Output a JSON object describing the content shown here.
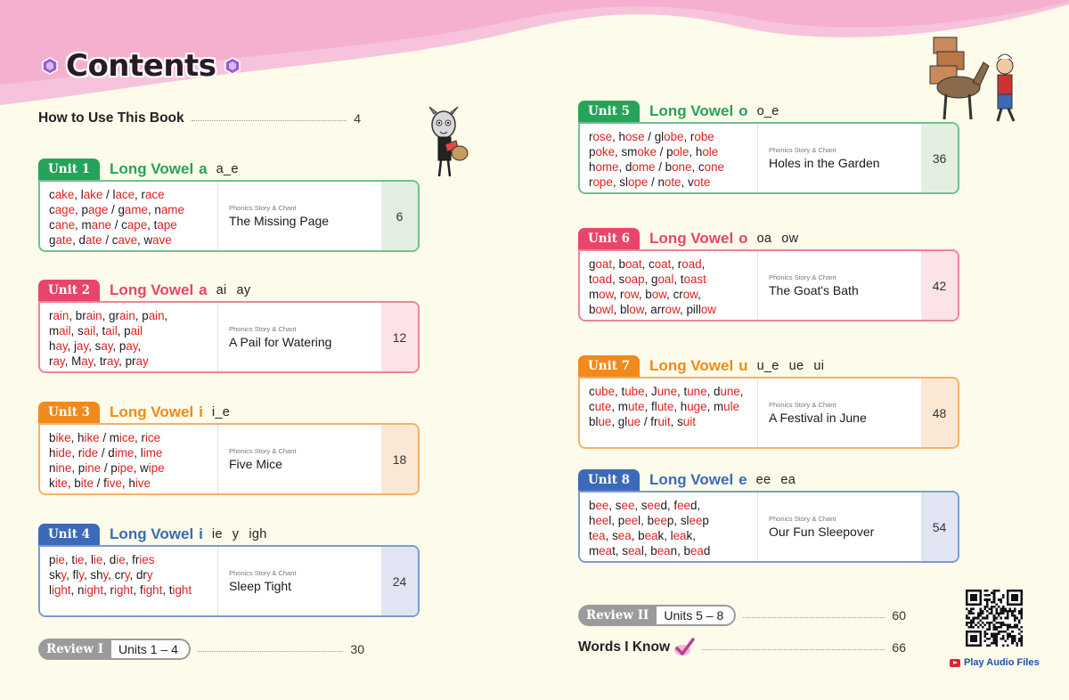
{
  "title": "Contents",
  "how_to_use": {
    "label": "How to Use This Book",
    "page": "4"
  },
  "story_label": "Phonics Story & Chant",
  "units": [
    {
      "tag": "Unit 1",
      "long_vowel": "Long Vowel",
      "letter": "a",
      "patterns": [
        "a_e"
      ],
      "color": "#26a35a",
      "bg": "#e3efe1",
      "words": [
        [
          [
            "c",
            "ake"
          ],
          [
            ", l",
            "ake"
          ],
          [
            " / l",
            "ace"
          ],
          [
            ", r",
            "ace"
          ]
        ],
        [
          [
            "c",
            "age"
          ],
          [
            ", p",
            "age"
          ],
          [
            " / g",
            "ame"
          ],
          [
            ", n",
            "ame"
          ]
        ],
        [
          [
            "c",
            "ane"
          ],
          [
            ", m",
            "ane"
          ],
          [
            " / c",
            "ape"
          ],
          [
            ", t",
            "ape"
          ]
        ],
        [
          [
            "g",
            "ate"
          ],
          [
            ", d",
            "ate"
          ],
          [
            " / c",
            "ave"
          ],
          [
            ", w",
            "ave"
          ]
        ]
      ],
      "story": "The Missing Page",
      "page": "6"
    },
    {
      "tag": "Unit 2",
      "long_vowel": "Long Vowel",
      "letter": "a",
      "patterns": [
        "ai",
        "ay"
      ],
      "color": "#e8456b",
      "bg": "#fbe3e7",
      "words": [
        [
          [
            "r",
            "ain"
          ],
          [
            ", br",
            "ain"
          ],
          [
            ", gr",
            "ain"
          ],
          [
            ", p",
            "ain"
          ],
          [
            ",",
            ""
          ]
        ],
        [
          [
            "m",
            "ail"
          ],
          [
            ", s",
            "ail"
          ],
          [
            ", t",
            "ail"
          ],
          [
            ", p",
            "ail"
          ]
        ],
        [
          [
            "h",
            "ay"
          ],
          [
            ", j",
            "ay"
          ],
          [
            ", s",
            "ay"
          ],
          [
            ", p",
            "ay"
          ],
          [
            ",",
            ""
          ]
        ],
        [
          [
            "r",
            "ay"
          ],
          [
            ", M",
            "ay"
          ],
          [
            ", tr",
            "ay"
          ],
          [
            ", pr",
            "ay"
          ]
        ]
      ],
      "story": "A Pail for Watering",
      "page": "12"
    },
    {
      "tag": "Unit 3",
      "long_vowel": "Long Vowel",
      "letter": "i",
      "patterns": [
        "i_e"
      ],
      "color": "#f08a1c",
      "bg": "#fbe8d4",
      "words": [
        [
          [
            "b",
            "ike"
          ],
          [
            ", h",
            "ike"
          ],
          [
            " / m",
            "ice"
          ],
          [
            ", r",
            "ice"
          ]
        ],
        [
          [
            "h",
            "ide"
          ],
          [
            ", r",
            "ide"
          ],
          [
            " / d",
            "ime"
          ],
          [
            ", l",
            "ime"
          ]
        ],
        [
          [
            "n",
            "ine"
          ],
          [
            ", p",
            "ine"
          ],
          [
            " / p",
            "ipe"
          ],
          [
            ", w",
            "ipe"
          ]
        ],
        [
          [
            "k",
            "ite"
          ],
          [
            ", b",
            "ite"
          ],
          [
            " / f",
            "ive"
          ],
          [
            ", h",
            "ive"
          ]
        ]
      ],
      "story": "Five Mice",
      "page": "18"
    },
    {
      "tag": "Unit 4",
      "long_vowel": "Long Vowel",
      "letter": "i",
      "patterns": [
        "ie",
        "y",
        "igh"
      ],
      "color": "#3b6ab8",
      "bg": "#e1e5f3",
      "words": [
        [
          [
            "p",
            "ie"
          ],
          [
            ", t",
            "ie"
          ],
          [
            ", l",
            "ie"
          ],
          [
            ", d",
            "ie"
          ],
          [
            ", fr",
            "ies"
          ]
        ],
        [
          [
            "sk",
            "y"
          ],
          [
            ", fl",
            "y"
          ],
          [
            ", sh",
            "y"
          ],
          [
            ", cr",
            "y"
          ],
          [
            ", dr",
            "y"
          ]
        ],
        [
          [
            "l",
            "ight"
          ],
          [
            ", n",
            "ight"
          ],
          [
            ", r",
            "ight"
          ],
          [
            ", f",
            "ight"
          ],
          [
            ", t",
            "ight"
          ]
        ]
      ],
      "story": "Sleep Tight",
      "page": "24"
    },
    {
      "tag": "Unit 5",
      "long_vowel": "Long Vowel",
      "letter": "o",
      "patterns": [
        "o_e"
      ],
      "color": "#26a35a",
      "bg": "#e3efe1",
      "words": [
        [
          [
            "r",
            "ose"
          ],
          [
            ", h",
            "ose"
          ],
          [
            " / gl",
            "obe"
          ],
          [
            ", r",
            "obe"
          ]
        ],
        [
          [
            "p",
            "oke"
          ],
          [
            ", sm",
            "oke"
          ],
          [
            " / p",
            "ole"
          ],
          [
            ", h",
            "ole"
          ]
        ],
        [
          [
            "h",
            "ome"
          ],
          [
            ", d",
            "ome"
          ],
          [
            " / b",
            "one"
          ],
          [
            ", c",
            "one"
          ]
        ],
        [
          [
            "r",
            "ope"
          ],
          [
            ", sl",
            "ope"
          ],
          [
            " / n",
            "ote"
          ],
          [
            ", v",
            "ote"
          ]
        ]
      ],
      "story": "Holes in the Garden",
      "page": "36"
    },
    {
      "tag": "Unit 6",
      "long_vowel": "Long Vowel",
      "letter": "o",
      "patterns": [
        "oa",
        "ow"
      ],
      "color": "#e8456b",
      "bg": "#fbe3e7",
      "words": [
        [
          [
            "g",
            "oat"
          ],
          [
            ", b",
            "oat"
          ],
          [
            ", c",
            "oat"
          ],
          [
            ", r",
            "oad"
          ],
          [
            ",",
            ""
          ]
        ],
        [
          [
            "t",
            "oad"
          ],
          [
            ", s",
            "oap"
          ],
          [
            ", g",
            "oal"
          ],
          [
            ", t",
            "oast"
          ]
        ],
        [
          [
            "m",
            "ow"
          ],
          [
            ", r",
            "ow"
          ],
          [
            ", b",
            "ow"
          ],
          [
            ", cr",
            "ow"
          ],
          [
            ",",
            ""
          ]
        ],
        [
          [
            "b",
            "owl"
          ],
          [
            ", bl",
            "ow"
          ],
          [
            ", arr",
            "ow"
          ],
          [
            ", pill",
            "ow"
          ]
        ]
      ],
      "story": "The Goat's Bath",
      "page": "42"
    },
    {
      "tag": "Unit 7",
      "long_vowel": "Long Vowel",
      "letter": "u",
      "patterns": [
        "u_e",
        "ue",
        "ui"
      ],
      "color": "#f08a1c",
      "bg": "#fbe8d4",
      "words": [
        [
          [
            "c",
            "ube"
          ],
          [
            ", t",
            "ube"
          ],
          [
            ", J",
            "une"
          ],
          [
            ", t",
            "une"
          ],
          [
            ", d",
            "une"
          ],
          [
            ",",
            ""
          ]
        ],
        [
          [
            "c",
            "ute"
          ],
          [
            ", m",
            "ute"
          ],
          [
            ", fl",
            "ute"
          ],
          [
            ", h",
            "uge"
          ],
          [
            ", m",
            "ule"
          ]
        ],
        [
          [
            "bl",
            "ue"
          ],
          [
            ", gl",
            "ue"
          ],
          [
            " / fr",
            "uit"
          ],
          [
            ", s",
            "uit"
          ]
        ]
      ],
      "story": "A Festival in June",
      "page": "48"
    },
    {
      "tag": "Unit 8",
      "long_vowel": "Long Vowel",
      "letter": "e",
      "patterns": [
        "ee",
        "ea"
      ],
      "color": "#3b6ab8",
      "bg": "#e1e5f3",
      "words": [
        [
          [
            "b",
            "ee"
          ],
          [
            ", s",
            "ee"
          ],
          [
            ", s",
            "ee",
            "d"
          ],
          [
            ", f",
            "ee",
            "d"
          ],
          [
            ",",
            ""
          ]
        ],
        [
          [
            "h",
            "ee",
            "l"
          ],
          [
            ", p",
            "ee",
            "l"
          ],
          [
            ", b",
            "ee",
            "p"
          ],
          [
            ", sl",
            "ee",
            "p"
          ]
        ],
        [
          [
            "t",
            "ea"
          ],
          [
            ", s",
            "ea"
          ],
          [
            ", b",
            "ea",
            "k"
          ],
          [
            ", l",
            "ea",
            "k"
          ],
          [
            ",",
            ""
          ]
        ],
        [
          [
            "m",
            "ea",
            "t"
          ],
          [
            ", s",
            "ea",
            "l"
          ],
          [
            ", b",
            "ea",
            "n"
          ],
          [
            ", b",
            "ea",
            "d"
          ]
        ]
      ],
      "story": "Our Fun Sleepover",
      "page": "54"
    }
  ],
  "review1": {
    "tag": "Review I",
    "units": "Units 1 – 4",
    "page": "30"
  },
  "review2": {
    "tag": "Review II",
    "units": "Units 5 – 8",
    "page": "60"
  },
  "words_i_know": {
    "label": "Words I Know",
    "page": "66"
  },
  "play_audio": "Play Audio Files",
  "colors": {
    "pink_wave": "#f5b8d4",
    "background": "#fdfbe9",
    "gray": "#9b9b9b",
    "red_word": "#e02020"
  }
}
